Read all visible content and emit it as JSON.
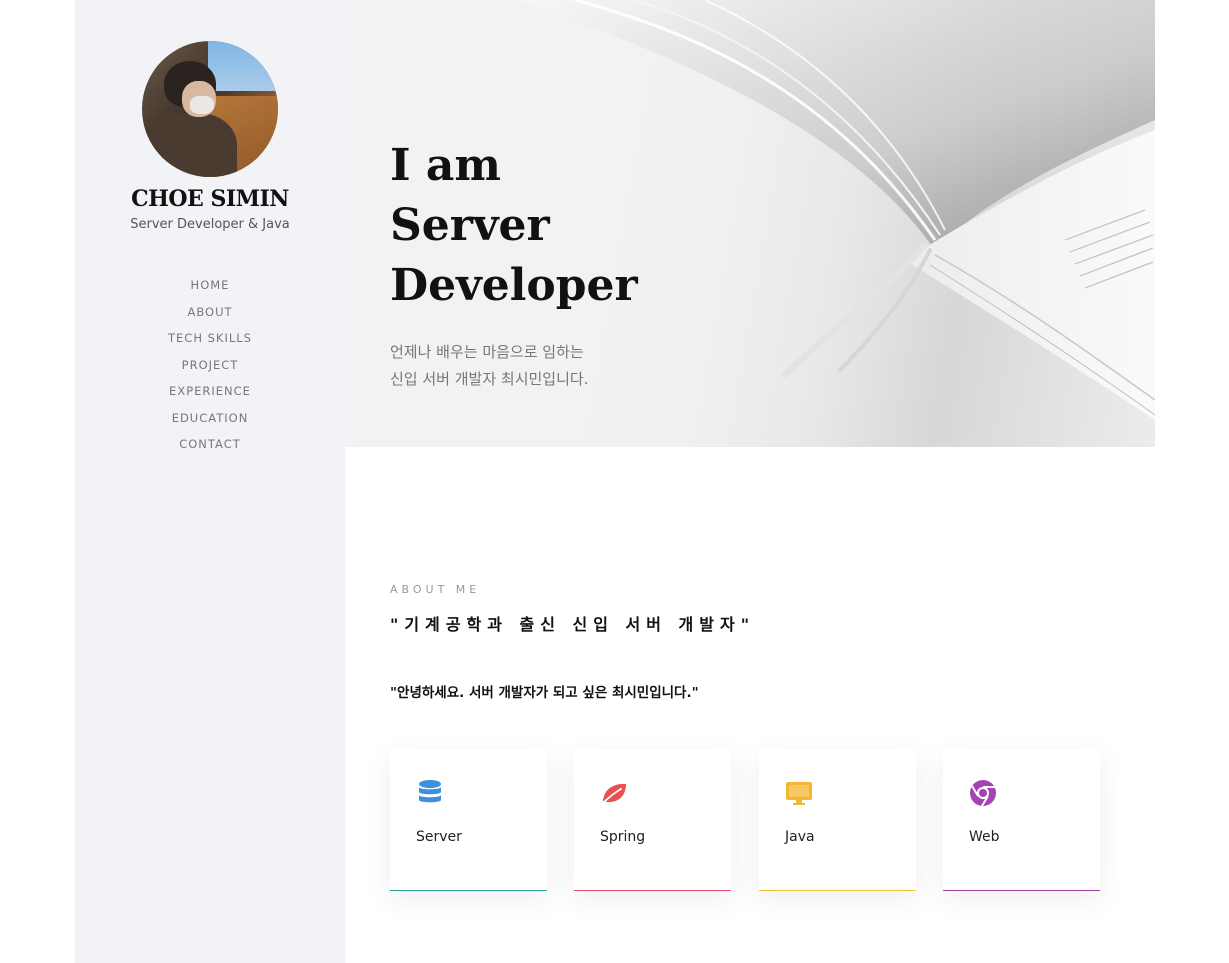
{
  "sidebar": {
    "name": "CHOE SIMIN",
    "role": "Server Developer & Java",
    "nav": [
      {
        "label": "HOME"
      },
      {
        "label": "ABOUT"
      },
      {
        "label": "TECH SKILLS"
      },
      {
        "label": "PROJECT"
      },
      {
        "label": "EXPERIENCE"
      },
      {
        "label": "EDUCATION"
      },
      {
        "label": "CONTACT"
      }
    ]
  },
  "hero": {
    "title_lines": [
      "I am",
      "Server",
      "Developer"
    ],
    "subtitle_lines": [
      "언제나 배우는 마음으로 임하는",
      "신입 서버 개발자 최시민입니다."
    ]
  },
  "about": {
    "label": "ABOUT ME",
    "heading": "\"기계공학과 출신 신입 서버 개발자\"",
    "greeting": "\"안녕하세요. 서버 개발자가 되고 싶은 최시민입니다.\""
  },
  "cards": [
    {
      "label": "Server",
      "icon": "database-icon",
      "color": "#3d8fe0",
      "bar_color": "#2aa198"
    },
    {
      "label": "Spring",
      "icon": "leaf-icon",
      "color": "#e8514f",
      "bar_color": "#e04e6a"
    },
    {
      "label": "Java",
      "icon": "monitor-icon",
      "color": "#f5b731",
      "bar_color": "#f2c230"
    },
    {
      "label": "Web",
      "icon": "chrome-icon",
      "color": "#a543b5",
      "bar_color": "#a53fa3"
    }
  ]
}
